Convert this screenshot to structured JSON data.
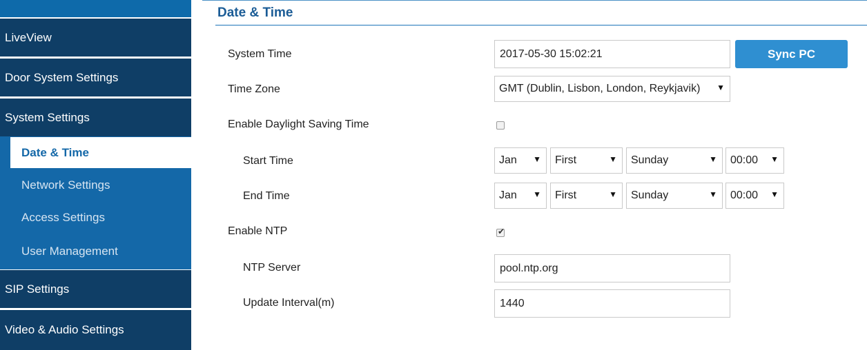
{
  "sidebar": {
    "main_items": [
      {
        "label": "LiveView"
      },
      {
        "label": "Door System Settings"
      },
      {
        "label": "System Settings"
      },
      {
        "label": "SIP Settings"
      },
      {
        "label": "Video & Audio Settings"
      }
    ],
    "sub_items": [
      {
        "label": "Date & Time",
        "active": true
      },
      {
        "label": "Network Settings"
      },
      {
        "label": "Access Settings"
      },
      {
        "label": "User Management"
      }
    ]
  },
  "page": {
    "title": "Date & Time"
  },
  "form": {
    "system_time": {
      "label": "System Time",
      "value": "2017-05-30 15:02:21"
    },
    "sync_button": "Sync PC",
    "time_zone": {
      "label": "Time Zone",
      "value": "GMT (Dublin, Lisbon, London, Reykjavik)"
    },
    "daylight_saving": {
      "label": "Enable Daylight Saving Time",
      "checked": false
    },
    "start_time": {
      "label": "Start Time",
      "month": "Jan",
      "week": "First",
      "day": "Sunday",
      "time": "00:00"
    },
    "end_time": {
      "label": "End Time",
      "month": "Jan",
      "week": "First",
      "day": "Sunday",
      "time": "00:00"
    },
    "enable_ntp": {
      "label": "Enable NTP",
      "checked": true
    },
    "ntp_server": {
      "label": "NTP Server",
      "value": "pool.ntp.org"
    },
    "update_interval": {
      "label": "Update Interval(m)",
      "value": "1440"
    }
  },
  "colors": {
    "sidebar_dark": "#0f3e66",
    "sidebar_sub": "#1468a8",
    "accent": "#2f8fd1",
    "title": "#1b5c96"
  },
  "icons": {
    "dropdown": "caret-down-icon",
    "checkbox": "checkbox-icon"
  }
}
